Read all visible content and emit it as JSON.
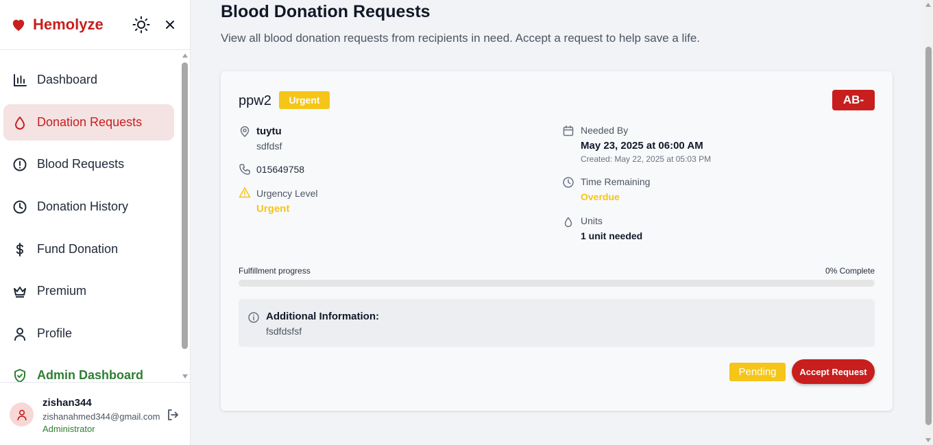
{
  "brand": {
    "name": "Hemolyze",
    "icon": "heart-icon"
  },
  "header_actions": {
    "theme_icon": "sun-icon",
    "close_icon": "close-icon"
  },
  "nav": [
    {
      "label": "Dashboard",
      "icon": "bar-chart-icon"
    },
    {
      "label": "Donation Requests",
      "icon": "droplet-icon"
    },
    {
      "label": "Blood Requests",
      "icon": "alert-circle-icon"
    },
    {
      "label": "Donation History",
      "icon": "clock-icon"
    },
    {
      "label": "Fund Donation",
      "icon": "dollar-icon"
    },
    {
      "label": "Premium",
      "icon": "crown-icon"
    },
    {
      "label": "Profile",
      "icon": "user-icon"
    },
    {
      "label": "Admin Dashboard",
      "icon": "shield-check-icon"
    }
  ],
  "user": {
    "name": "zishan344",
    "email": "zishanahmed344@gmail.com",
    "role": "Administrator"
  },
  "page": {
    "title": "Blood Donation Requests",
    "subtitle": "View all blood donation requests from recipients in need. Accept a request to help save a life."
  },
  "request": {
    "name": "ppw2",
    "urgency_badge": "Urgent",
    "blood_type": "AB-",
    "location_name": "tuytu",
    "location_address": "sdfdsf",
    "phone": "015649758",
    "urgency_label": "Urgency Level",
    "urgency_value": "Urgent",
    "needed_by_label": "Needed By",
    "needed_by_value": "May 23, 2025 at 06:00 AM",
    "created": "Created: May 22, 2025 at 05:03 PM",
    "time_remaining_label": "Time Remaining",
    "time_remaining_value": "Overdue",
    "units_label": "Units",
    "units_value": "1 unit needed",
    "progress_label": "Fulfillment progress",
    "progress_text": "0% Complete",
    "progress_fraction": 0,
    "info_title": "Additional Information:",
    "info_text": "fsdfdsfsf",
    "status": "Pending",
    "accept_label": "Accept Request"
  },
  "colors": {
    "brand_red": "#c81e1e",
    "urgent_yellow": "#f5c518",
    "admin_green": "#2e7d32",
    "active_bg": "#f5e2e2"
  }
}
